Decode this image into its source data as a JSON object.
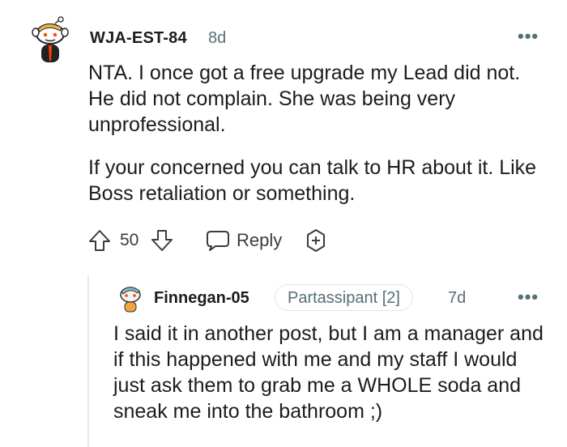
{
  "comment": {
    "author": "WJA-EST-84",
    "age": "8d",
    "more": "•••",
    "paragraphs": [
      "NTA. I once got a free upgrade my Lead did not. He did not complain. She was being very unprofessional.",
      "If your concerned you can talk to HR about it. Like Boss retaliation or something."
    ],
    "score": "50",
    "reply_label": "Reply",
    "icons": {
      "avatar": "snoo-avatar-icon",
      "upvote": "upvote-arrow-icon",
      "downvote": "downvote-arrow-icon",
      "reply": "speech-bubble-icon",
      "award": "award-plus-icon"
    }
  },
  "reply": {
    "author": "Finnegan-05",
    "flair": "Partassipant [2]",
    "age": "7d",
    "more": "•••",
    "text": "I said it in another post, but I am a manager and if this happened with me and my staff I would just ask them to grab me a WHOLE soda and sneak me into the bathroom ;)",
    "icons": {
      "avatar": "snoo-avatar-icon"
    }
  },
  "colors": {
    "text": "#1c1c1c",
    "meta": "#576f76",
    "icon": "#3c3c3c",
    "thread_line": "#e5ebee",
    "avatar_accent": "#ff4500"
  }
}
